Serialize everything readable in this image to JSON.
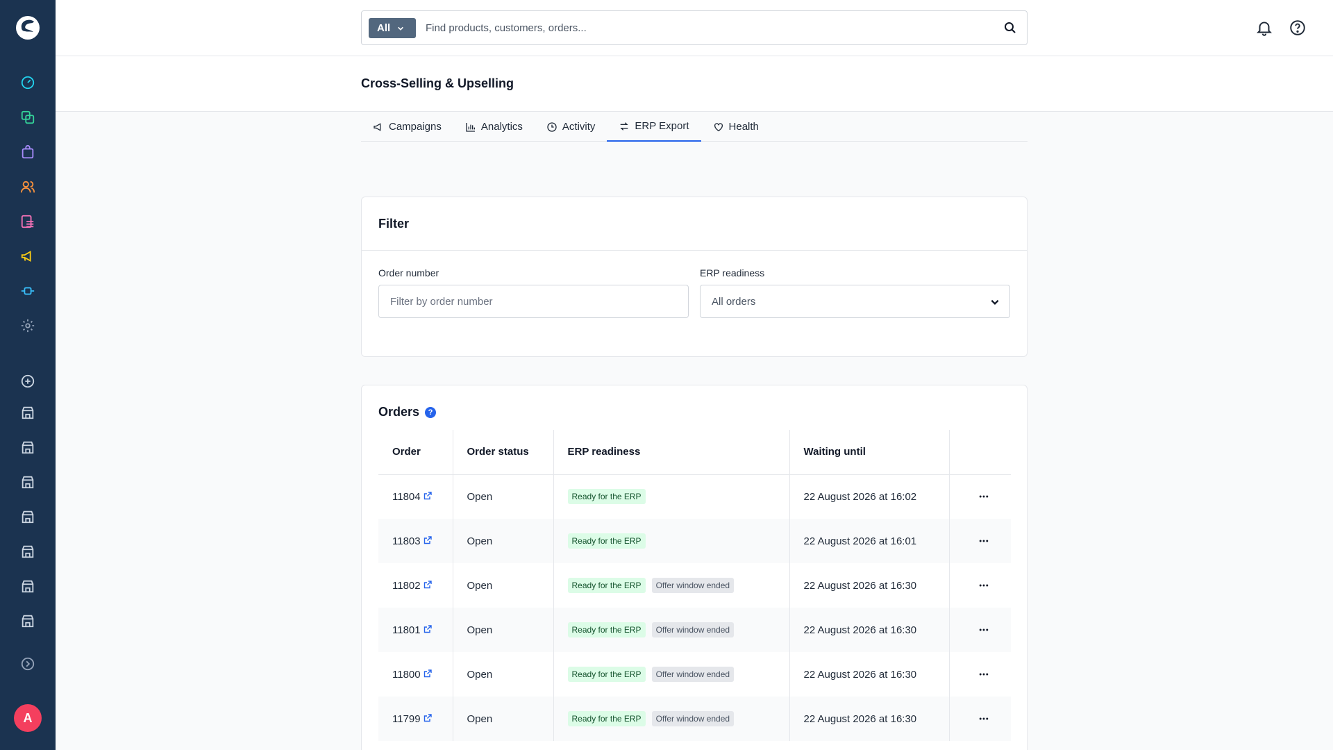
{
  "search": {
    "type_label": "All",
    "placeholder": "Find products, customers, orders..."
  },
  "page": {
    "title": "Cross-Selling & Upselling"
  },
  "tabs": [
    {
      "label": "Campaigns",
      "icon": "megaphone-icon"
    },
    {
      "label": "Analytics",
      "icon": "bar-chart-icon"
    },
    {
      "label": "Activity",
      "icon": "clock-icon"
    },
    {
      "label": "ERP Export",
      "icon": "arrows-exchange-icon",
      "active": true
    },
    {
      "label": "Health",
      "icon": "heart-icon"
    }
  ],
  "filter": {
    "title": "Filter",
    "order_number_label": "Order number",
    "order_number_placeholder": "Filter by order number",
    "erp_label": "ERP readiness",
    "erp_value": "All orders"
  },
  "orders": {
    "title": "Orders",
    "help": "?",
    "columns": [
      "Order",
      "Order status",
      "ERP readiness",
      "Waiting until",
      ""
    ],
    "rows": [
      {
        "order": "11804",
        "status": "Open",
        "badges": [
          "Ready for the ERP"
        ],
        "waiting": "22 August 2026 at 16:02"
      },
      {
        "order": "11803",
        "status": "Open",
        "badges": [
          "Ready for the ERP"
        ],
        "waiting": "22 August 2026 at 16:01"
      },
      {
        "order": "11802",
        "status": "Open",
        "badges": [
          "Ready for the ERP",
          "Offer window ended"
        ],
        "waiting": "22 August 2026 at 16:30"
      },
      {
        "order": "11801",
        "status": "Open",
        "badges": [
          "Ready for the ERP",
          "Offer window ended"
        ],
        "waiting": "22 August 2026 at 16:30"
      },
      {
        "order": "11800",
        "status": "Open",
        "badges": [
          "Ready for the ERP",
          "Offer window ended"
        ],
        "waiting": "22 August 2026 at 16:30"
      },
      {
        "order": "11799",
        "status": "Open",
        "badges": [
          "Ready for the ERP",
          "Offer window ended"
        ],
        "waiting": "22 August 2026 at 16:30"
      }
    ]
  },
  "user": {
    "avatar_initial": "A"
  },
  "colors": {
    "sidebar": "#1b3350",
    "accent": "#2563eb",
    "badge_ready": "#dcfce7",
    "badge_ended": "#e5e7eb",
    "avatar": "#f43f5e"
  }
}
